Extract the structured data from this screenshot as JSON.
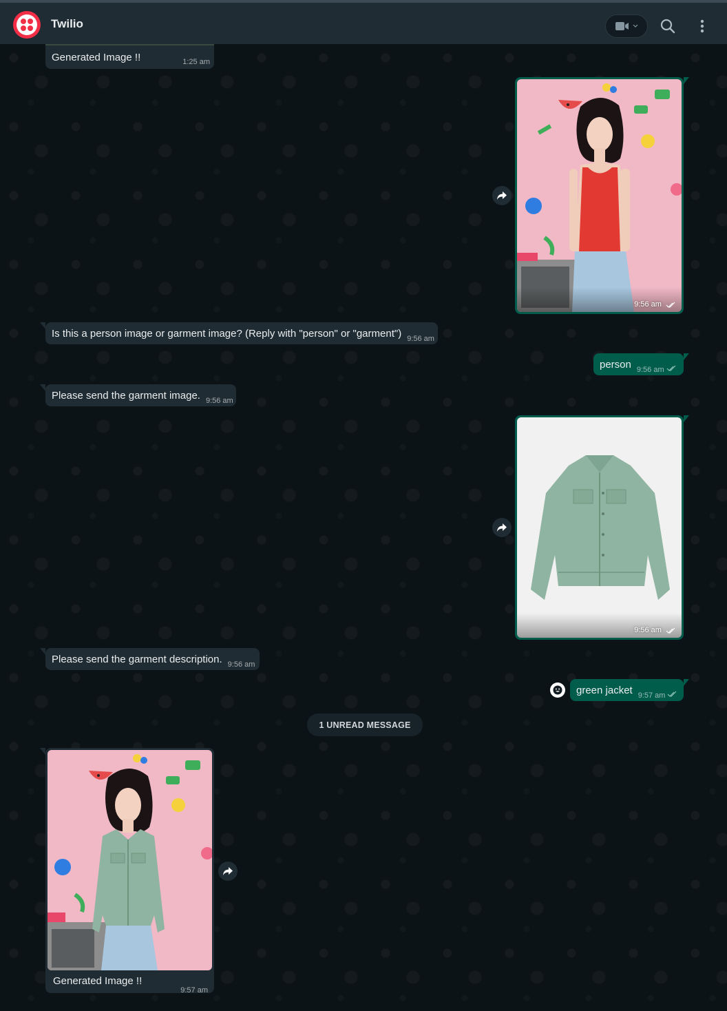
{
  "header": {
    "title": "Twilio",
    "video_icon": "video-camera-icon",
    "search_icon": "search-icon",
    "menu_icon": "more-vertical-icon",
    "brand_color": "#f22f46"
  },
  "messages": [
    {
      "direction": "incoming",
      "type": "image-caption",
      "text": "Generated Image !!",
      "time": "1:25 am"
    },
    {
      "direction": "outgoing",
      "type": "image",
      "image": "person photo: woman in red tank top on pink background",
      "time": "9:56 am",
      "status": "read"
    },
    {
      "direction": "incoming",
      "type": "text",
      "text": "Is this a person image or garment image? (Reply with \"person\" or \"garment\")",
      "time": "9:56 am"
    },
    {
      "direction": "outgoing",
      "type": "text",
      "text": "person",
      "time": "9:56 am",
      "status": "read"
    },
    {
      "direction": "incoming",
      "type": "text",
      "text": "Please send the garment image.",
      "time": "9:56 am"
    },
    {
      "direction": "outgoing",
      "type": "image",
      "image": "garment photo: green suede jacket",
      "time": "9:56 am",
      "status": "read"
    },
    {
      "direction": "incoming",
      "type": "text",
      "text": "Please send the garment description.",
      "time": "9:56 am"
    },
    {
      "direction": "outgoing",
      "type": "text",
      "text": "green jacket",
      "time": "9:57 am",
      "status": "read"
    },
    {
      "direction": "incoming",
      "type": "image",
      "image": "generated try-on photo: woman wearing green jacket",
      "caption": "Generated Image !!",
      "time": "9:57 am"
    }
  ],
  "unread_divider": "1 UNREAD MESSAGE",
  "colors": {
    "incoming_bubble": "#202c33",
    "outgoing_bubble": "#005c4b",
    "chat_background": "#0c1317"
  }
}
